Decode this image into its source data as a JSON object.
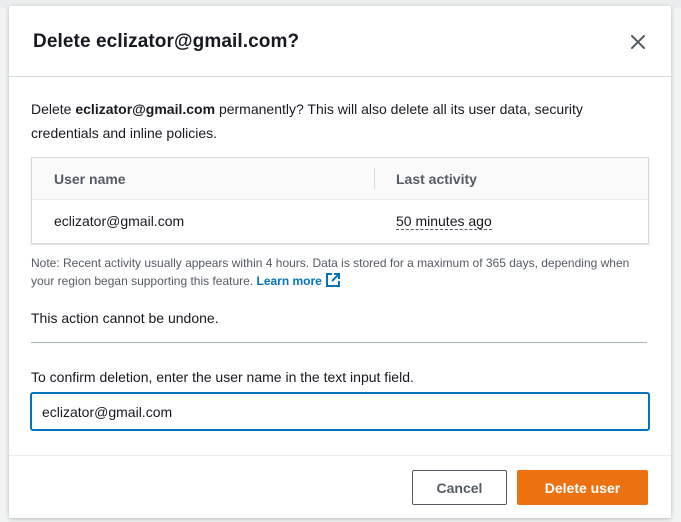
{
  "dialog": {
    "title": "Delete eclizator@gmail.com?",
    "close_icon": "close-icon"
  },
  "intro": {
    "prefix": "Delete ",
    "username": "eclizator@gmail.com",
    "suffix": " permanently? This will also delete all its user data, security credentials and inline policies."
  },
  "table": {
    "headers": [
      "User name",
      "Last activity"
    ],
    "rows": [
      {
        "user_name": "eclizator@gmail.com",
        "last_activity": "50 minutes ago"
      }
    ]
  },
  "note": {
    "text": "Note: Recent activity usually appears within 4 hours. Data is stored for a maximum of 365 days, depending when your region began supporting this feature. ",
    "link_label": "Learn more",
    "link_icon": "external-link-icon"
  },
  "warning": "This action cannot be undone.",
  "confirm": {
    "label": "To confirm deletion, enter the user name in the text input field.",
    "value": "eclizator@gmail.com"
  },
  "footer": {
    "cancel_label": "Cancel",
    "delete_label": "Delete user"
  },
  "colors": {
    "primary_button": "#ec7211",
    "link": "#0073bb",
    "focus_border": "#0073bb"
  }
}
